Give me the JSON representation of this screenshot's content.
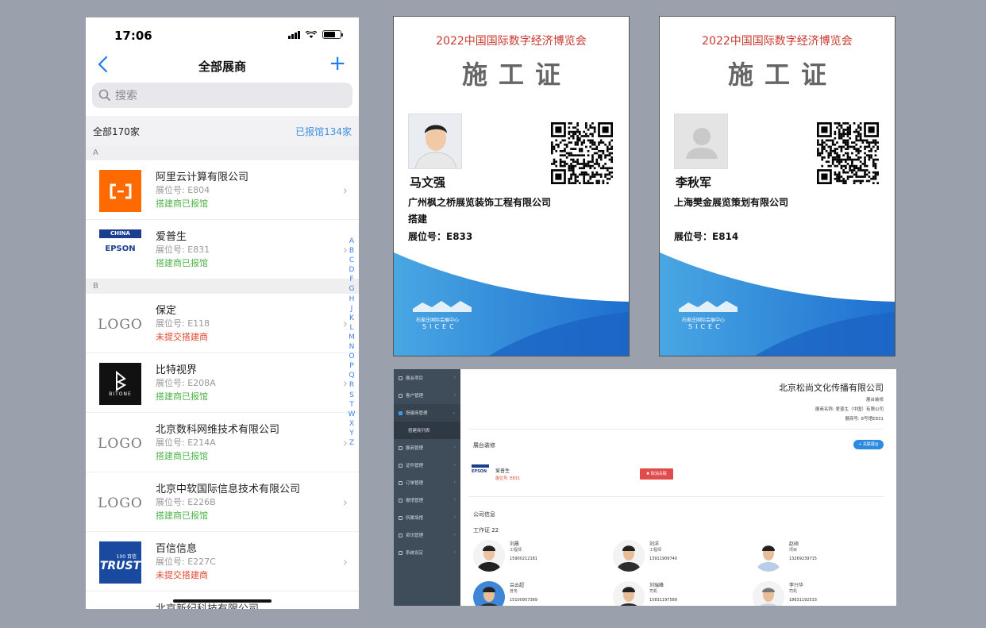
{
  "phone": {
    "status_time": "17:06",
    "nav": {
      "title": "全部展商",
      "add_label": "+"
    },
    "search_placeholder": "搜索",
    "summary": {
      "total": "全部170家",
      "registered": "已报馆134家"
    },
    "sections": [
      {
        "letter": "A",
        "rows": [
          {
            "logo": "aliyun",
            "name": "阿里云计算有限公司",
            "booth": "展位号: E804",
            "status": "搭建商已报馆",
            "ok": true
          },
          {
            "logo": "epson",
            "name": "爱普生",
            "booth": "展位号: E831",
            "status": "搭建商已报馆",
            "ok": true
          }
        ]
      },
      {
        "letter": "B",
        "rows": [
          {
            "logo": "logo",
            "name": "保定",
            "booth": "展位号: E118",
            "status": "未提交搭建商",
            "ok": false
          },
          {
            "logo": "bitone",
            "name": "比特视界",
            "booth": "展位号: E208A",
            "status": "搭建商已报馆",
            "ok": true
          },
          {
            "logo": "logo",
            "name": "北京数科网维技术有限公司",
            "booth": "展位号: E214A",
            "status": "搭建商已报馆",
            "ok": true
          },
          {
            "logo": "logo",
            "name": "北京中软国际信息技术有限公司",
            "booth": "展位号: E226B",
            "status": "搭建商已报馆",
            "ok": true
          },
          {
            "logo": "trust",
            "name": "百信信息",
            "booth": "展位号: E227C",
            "status": "未提交搭建商",
            "ok": false
          }
        ]
      }
    ],
    "cut_text": "北京新纪科技有限公司",
    "logo_words": {
      "logo": "LOGO",
      "china": "CHINA",
      "epson": "EPSON",
      "bitone": "BITONE",
      "trust": "TRUST",
      "trust_small": "100 百信"
    },
    "index_letters": [
      "A",
      "B",
      "C",
      "D",
      "F",
      "G",
      "H",
      "J",
      "K",
      "L",
      "M",
      "N",
      "O",
      "P",
      "Q",
      "R",
      "S",
      "T",
      "W",
      "X",
      "Y",
      "Z"
    ]
  },
  "badges": [
    {
      "expo": "2022中国国际数字经济博览会",
      "title": "施工证",
      "person": "马文强",
      "company": "广州枫之桥展览装饰工程有限公司",
      "role": "搭建",
      "booth": "展位号：E833",
      "photo": "real"
    },
    {
      "expo": "2022中国国际数字经济博览会",
      "title": "施工证",
      "person": "李秋军",
      "company": "上海樊金展览策划有限公司",
      "role": "",
      "booth": "展位号：E814",
      "photo": "placeholder"
    }
  ],
  "venue": {
    "cn": "石家庄国际会展中心",
    "en": "SICEC"
  },
  "admin": {
    "sidebar": [
      {
        "label": "展会项目"
      },
      {
        "label": "客户管理"
      },
      {
        "label": "搭建商管理",
        "active": true,
        "sub": "搭建商列表"
      },
      {
        "label": "展商管理"
      },
      {
        "label": "证件管理"
      },
      {
        "label": "订单管理"
      },
      {
        "label": "报馆管理"
      },
      {
        "label": "所属场馆"
      },
      {
        "label": "资讯管理"
      },
      {
        "label": "系统设定"
      }
    ],
    "company": "北京松尚文化传播有限公司",
    "sub1": "展台装修",
    "sub2": "展商名称: 爱普生（中国）有限公司",
    "sub3": "展商号: 8号馆E831",
    "section_booth": "展台装修",
    "add_booth": "+ 关联展台",
    "exhibitor_name": "爱普生",
    "exhibitor_booth": "展位号: E831",
    "unbind": "✖ 取消关联",
    "section_company": "公司信息",
    "cert_count": "工作证 22",
    "people": [
      {
        "name": "刘晨",
        "role": "工程师",
        "phone": "15900212181"
      },
      {
        "name": "刘洋",
        "role": "工程师",
        "phone": "13911909740"
      },
      {
        "name": "赵硕",
        "role": "项目",
        "phone": "13269239715"
      },
      {
        "name": "吕云超",
        "role": "普务",
        "phone": "15100957369"
      },
      {
        "name": "刘瑞峰",
        "role": "司机",
        "phone": "15831197589"
      },
      {
        "name": "李兴华",
        "role": "司机",
        "phone": "18631192533"
      }
    ]
  }
}
